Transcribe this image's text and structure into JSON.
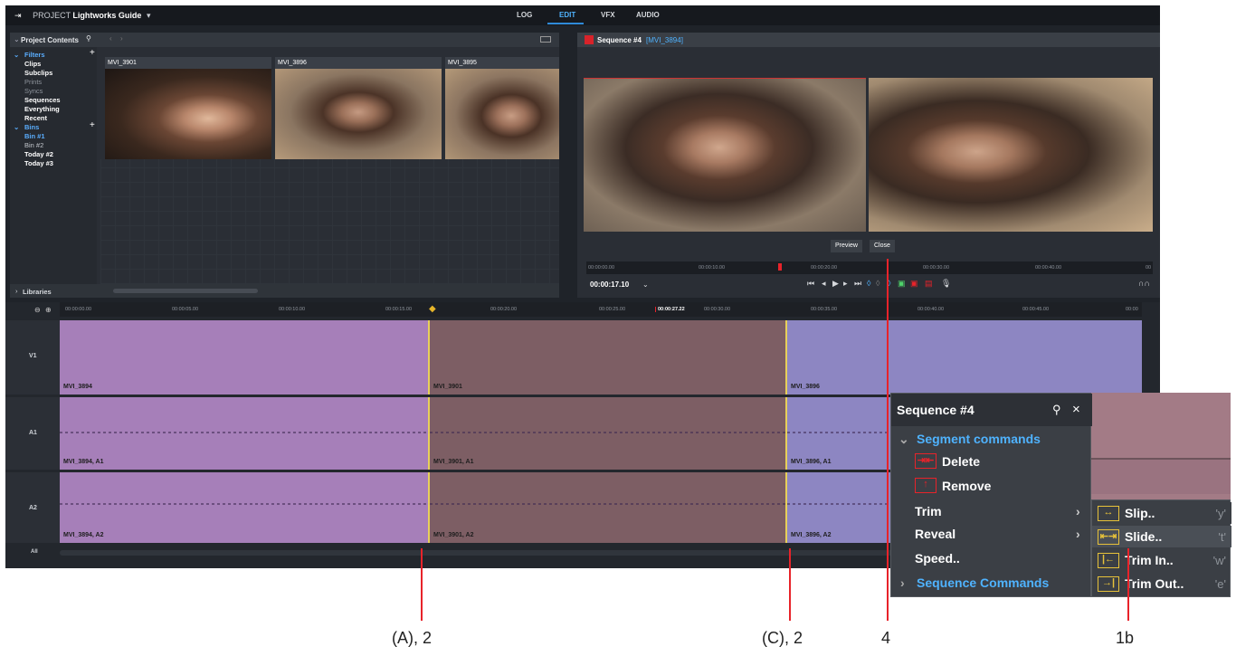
{
  "topbar": {
    "project_prefix": "PROJECT",
    "project_name": "Lightworks Guide",
    "tabs": [
      "LOG",
      "EDIT",
      "VFX",
      "AUDIO"
    ],
    "active_tab": "EDIT"
  },
  "project_panel": {
    "title": "Project Contents",
    "filters_label": "Filters",
    "filters": [
      "Clips",
      "Subclips",
      "Prints",
      "Syncs",
      "Sequences",
      "Everything",
      "Recent"
    ],
    "bins_label": "Bins",
    "bins": [
      "Bin #1",
      "Bin #2",
      "Today #2",
      "Today #3"
    ],
    "libraries_label": "Libraries",
    "clips": [
      "MVI_3901",
      "MVI_3896",
      "MVI_3895"
    ]
  },
  "viewer": {
    "title": "Sequence #4",
    "subtitle": "[MVI_3894]",
    "preview_button": "Preview",
    "close_button": "Close",
    "ruler_times": [
      "00:00:00.00",
      "00:00:10.00",
      "00:00:20.00",
      "00:00:30.00",
      "00:00:40.00",
      "00"
    ],
    "timecode": "00:00:17.10"
  },
  "timeline": {
    "ruler_times": [
      "00:00:00.00",
      "00:00:05.00",
      "00:00:10.00",
      "00:00:15.00",
      "00:00:20.00",
      "00:00:25.00",
      "00:00:27.22",
      "00:00:30.00",
      "00:00:35.00",
      "00:00:40.00",
      "00:00:45.00",
      "00:00"
    ],
    "tracks": [
      "V1",
      "A1",
      "A2",
      "All"
    ],
    "v1_segments": [
      "MVI_3894",
      "MVI_3901",
      "MVI_3896"
    ],
    "a1_segments": [
      "MVI_3894, A1",
      "MVI_3901, A1",
      "MVI_3896, A1"
    ],
    "a2_segments": [
      "MVI_3894, A2",
      "MVI_3901, A2",
      "MVI_3896, A2"
    ]
  },
  "context_menu": {
    "title": "Sequence #4",
    "segment_commands": "Segment commands",
    "delete": "Delete",
    "remove": "Remove",
    "trim": "Trim",
    "reveal": "Reveal",
    "speed": "Speed..",
    "sequence_commands": "Sequence Commands"
  },
  "submenu": [
    {
      "label": "Slip..",
      "shortcut": "'y'"
    },
    {
      "label": "Slide..",
      "shortcut": "'t'"
    },
    {
      "label": "Trim In..",
      "shortcut": "'w'"
    },
    {
      "label": "Trim Out..",
      "shortcut": "'e'"
    }
  ],
  "callouts": [
    "(A), 2",
    "(C), 2",
    "4",
    "1b"
  ],
  "colors": {
    "segment_purple": "#a67fb9",
    "segment_brown": "#7d5e64",
    "segment_blue": "#8d86c2",
    "accent_blue": "#4fb3ff",
    "callout_red": "#e8232a",
    "trim_yellow": "#e7d05a"
  }
}
